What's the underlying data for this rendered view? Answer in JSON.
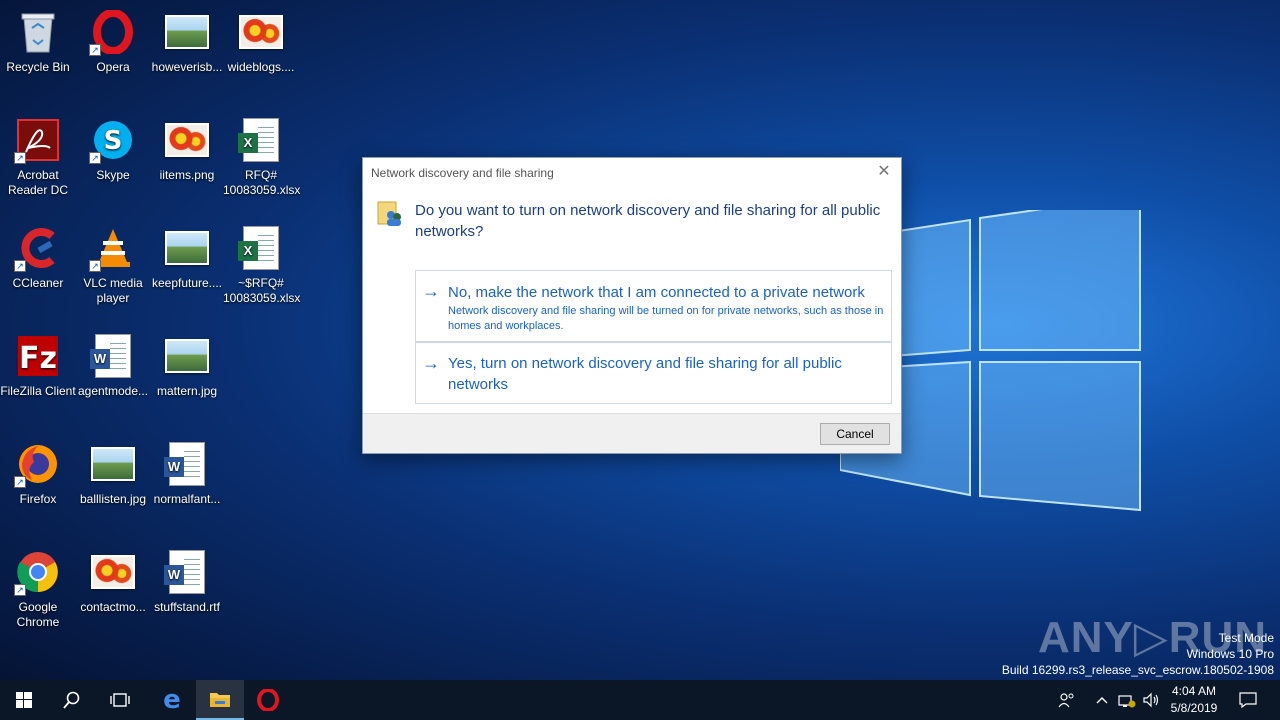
{
  "desktop": {
    "icons": [
      {
        "label": "Recycle Bin",
        "icon": "recycle-bin-icon"
      },
      {
        "label": "Opera",
        "icon": "opera-icon"
      },
      {
        "label": "howeverisb...",
        "icon": "image-file-icon"
      },
      {
        "label": "wideblogs....",
        "icon": "image-file-icon"
      },
      {
        "label": "Acrobat Reader DC",
        "icon": "acrobat-icon"
      },
      {
        "label": "Skype",
        "icon": "skype-icon"
      },
      {
        "label": "iitems.png",
        "icon": "image-file-icon"
      },
      {
        "label": "RFQ# 10083059.xlsx",
        "icon": "excel-file-icon"
      },
      {
        "label": "CCleaner",
        "icon": "ccleaner-icon"
      },
      {
        "label": "VLC media player",
        "icon": "vlc-icon"
      },
      {
        "label": "keepfuture....",
        "icon": "image-file-icon"
      },
      {
        "label": "~$RFQ# 10083059.xlsx",
        "icon": "excel-file-icon"
      },
      {
        "label": "FileZilla Client",
        "icon": "filezilla-icon"
      },
      {
        "label": "agentmode...",
        "icon": "word-file-icon"
      },
      {
        "label": "mattern.jpg",
        "icon": "image-file-icon"
      },
      {
        "label": "Firefox",
        "icon": "firefox-icon"
      },
      {
        "label": "balllisten.jpg",
        "icon": "image-file-icon"
      },
      {
        "label": "normalfant...",
        "icon": "word-file-icon"
      },
      {
        "label": "Google Chrome",
        "icon": "chrome-icon"
      },
      {
        "label": "contactmo...",
        "icon": "image-file-icon"
      },
      {
        "label": "stuffstand.rtf",
        "icon": "word-file-icon"
      }
    ]
  },
  "dialog": {
    "title": "Network discovery and file sharing",
    "close": "✕",
    "question": "Do you want to turn on network discovery and file sharing for all public networks?",
    "option1": {
      "title": "No, make the network that I am connected to a private network",
      "description": "Network discovery and file sharing will be turned on for private networks, such as those in homes and workplaces."
    },
    "option2": {
      "title": "Yes, turn on network discovery and file sharing for all public networks"
    },
    "cancel_label": "Cancel"
  },
  "watermark": {
    "brand": "ANY▷RUN",
    "line1": "Test Mode",
    "line2": "Windows 10 Pro",
    "line3": "Build 16299.rs3_release_svc_escrow.180502-1908"
  },
  "taskbar": {
    "clock_time": "4:04 AM",
    "clock_date": "5/8/2019"
  },
  "colors": {
    "accent": "#1b62c4",
    "taskbar": "#0b1626"
  }
}
